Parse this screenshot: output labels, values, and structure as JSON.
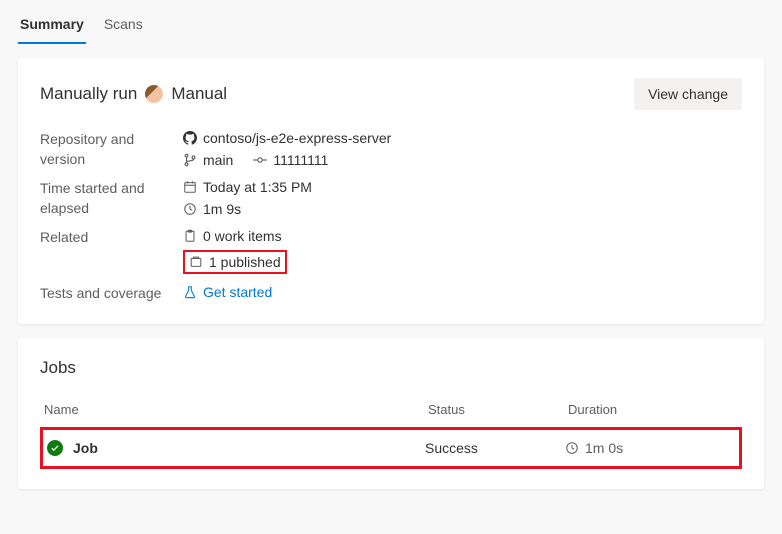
{
  "tabs": {
    "summary": "Summary",
    "scans": "Scans"
  },
  "summary": {
    "title_prefix": "Manually run",
    "title_suffix": "Manual",
    "view_change": "View change",
    "labels": {
      "repo": "Repository and version",
      "time": "Time started and elapsed",
      "related": "Related",
      "tests": "Tests and coverage"
    },
    "repo_name": "contoso/js-e2e-express-server",
    "branch": "main",
    "commit": "11111111",
    "started": "Today at 1:35 PM",
    "elapsed": "1m 9s",
    "work_items": "0 work items",
    "published": "1 published",
    "get_started": "Get started"
  },
  "jobs": {
    "title": "Jobs",
    "columns": {
      "name": "Name",
      "status": "Status",
      "duration": "Duration"
    },
    "row": {
      "name": "Job",
      "status": "Success",
      "duration": "1m 0s"
    }
  }
}
